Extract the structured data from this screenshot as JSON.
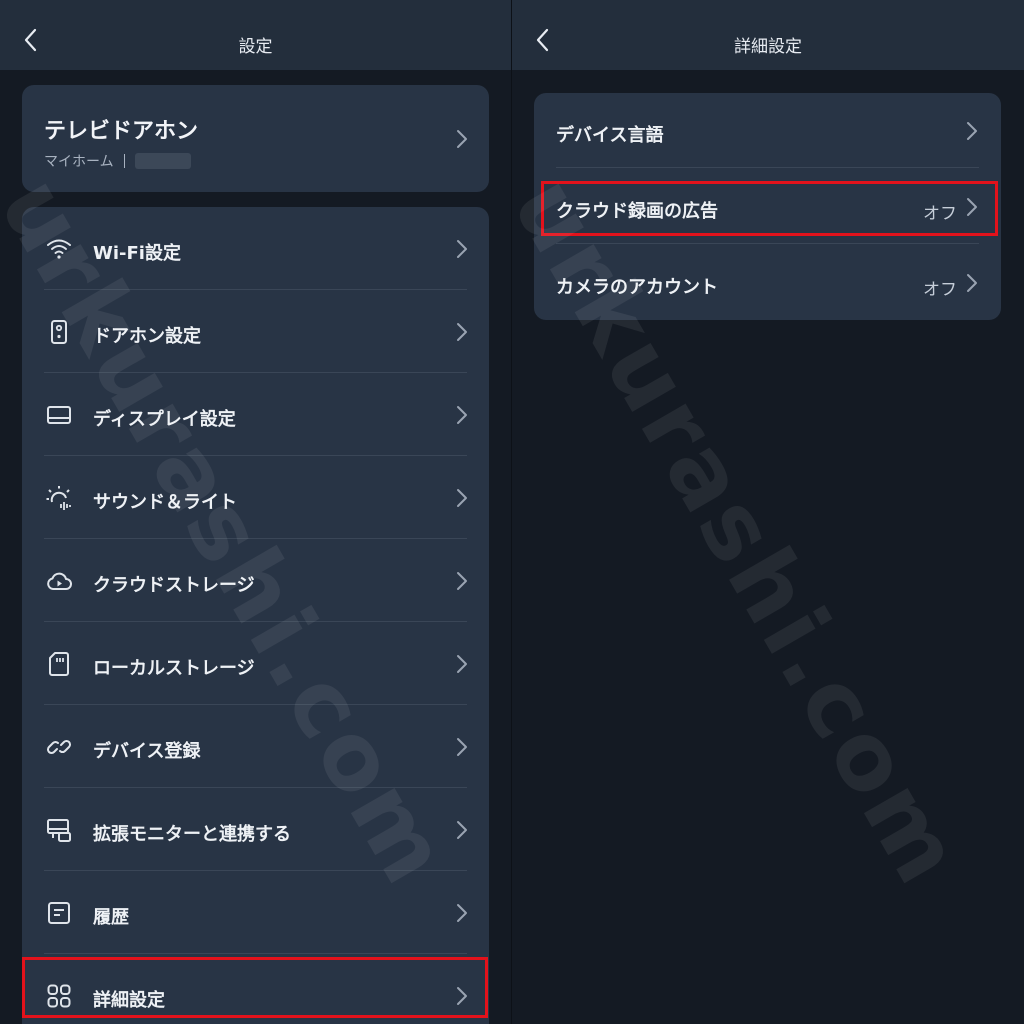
{
  "left": {
    "header": {
      "title": "設定",
      "back_icon": "chevron-left-icon"
    },
    "device": {
      "name": "テレビドアホン",
      "location": "マイホーム"
    },
    "menu": [
      {
        "label": "Wi-Fi設定",
        "icon": "wifi-icon"
      },
      {
        "label": "ドアホン設定",
        "icon": "doorphone-icon"
      },
      {
        "label": "ディスプレイ設定",
        "icon": "display-icon"
      },
      {
        "label": "サウンド＆ライト",
        "icon": "sound-light-icon"
      },
      {
        "label": "クラウドストレージ",
        "icon": "cloud-play-icon"
      },
      {
        "label": "ローカルストレージ",
        "icon": "sd-card-icon"
      },
      {
        "label": "デバイス登録",
        "icon": "link-icon"
      },
      {
        "label": "拡張モニターと連携する",
        "icon": "monitor-icon"
      },
      {
        "label": "履歴",
        "icon": "history-icon"
      },
      {
        "label": "詳細設定",
        "icon": "grid-icon"
      }
    ]
  },
  "right": {
    "header": {
      "title": "詳細設定",
      "back_icon": "chevron-left-icon"
    },
    "items": [
      {
        "label": "デバイス言語",
        "value": ""
      },
      {
        "label": "クラウド録画の広告",
        "value": "オフ"
      },
      {
        "label": "カメラのアカウント",
        "value": "オフ"
      }
    ]
  },
  "watermark": "urkurashi.com",
  "colors": {
    "highlight": "#e3121b",
    "card": "#283445",
    "header": "#232e3c",
    "background": "#141a23"
  }
}
